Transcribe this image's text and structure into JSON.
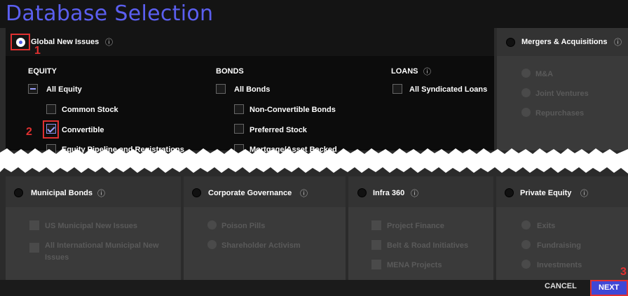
{
  "title": "Database Selection",
  "global_new_issues": {
    "label": "Global New Issues",
    "info_icon": "info-icon",
    "equity": {
      "header": "EQUITY",
      "all": "All Equity",
      "items": [
        "Common Stock",
        "Convertible",
        "Equity Pipeline and Registrations"
      ]
    },
    "bonds": {
      "header": "BONDS",
      "all": "All Bonds",
      "items": [
        "Non-Convertible Bonds",
        "Preferred Stock",
        "Mortgage/Asset Backed"
      ]
    },
    "loans": {
      "header": "LOANS",
      "all": "All Syndicated Loans"
    }
  },
  "mergers": {
    "label": "Mergers & Acquisitions",
    "items": [
      "M&A",
      "Joint Ventures",
      "Repurchases"
    ]
  },
  "municipal": {
    "label": "Municipal Bonds",
    "items": [
      "US Municipal New Issues",
      "All International Municipal New",
      "Issues"
    ]
  },
  "governance": {
    "label": "Corporate Governance",
    "items": [
      "Poison Pills",
      "Shareholder Activism"
    ]
  },
  "infra": {
    "label": "Infra 360",
    "items": [
      "Project Finance",
      "Belt & Road Initiatives",
      "MENA Projects"
    ]
  },
  "private_equity": {
    "label": "Private Equity",
    "items": [
      "Exits",
      "Fundraising",
      "Investments"
    ]
  },
  "markers": [
    "1",
    "2",
    "3"
  ],
  "footer": {
    "cancel": "CANCEL",
    "next": "NEXT"
  },
  "colors": {
    "accent": "#3f47d6",
    "title": "#5b5ff0",
    "highlight": "#e03030"
  }
}
